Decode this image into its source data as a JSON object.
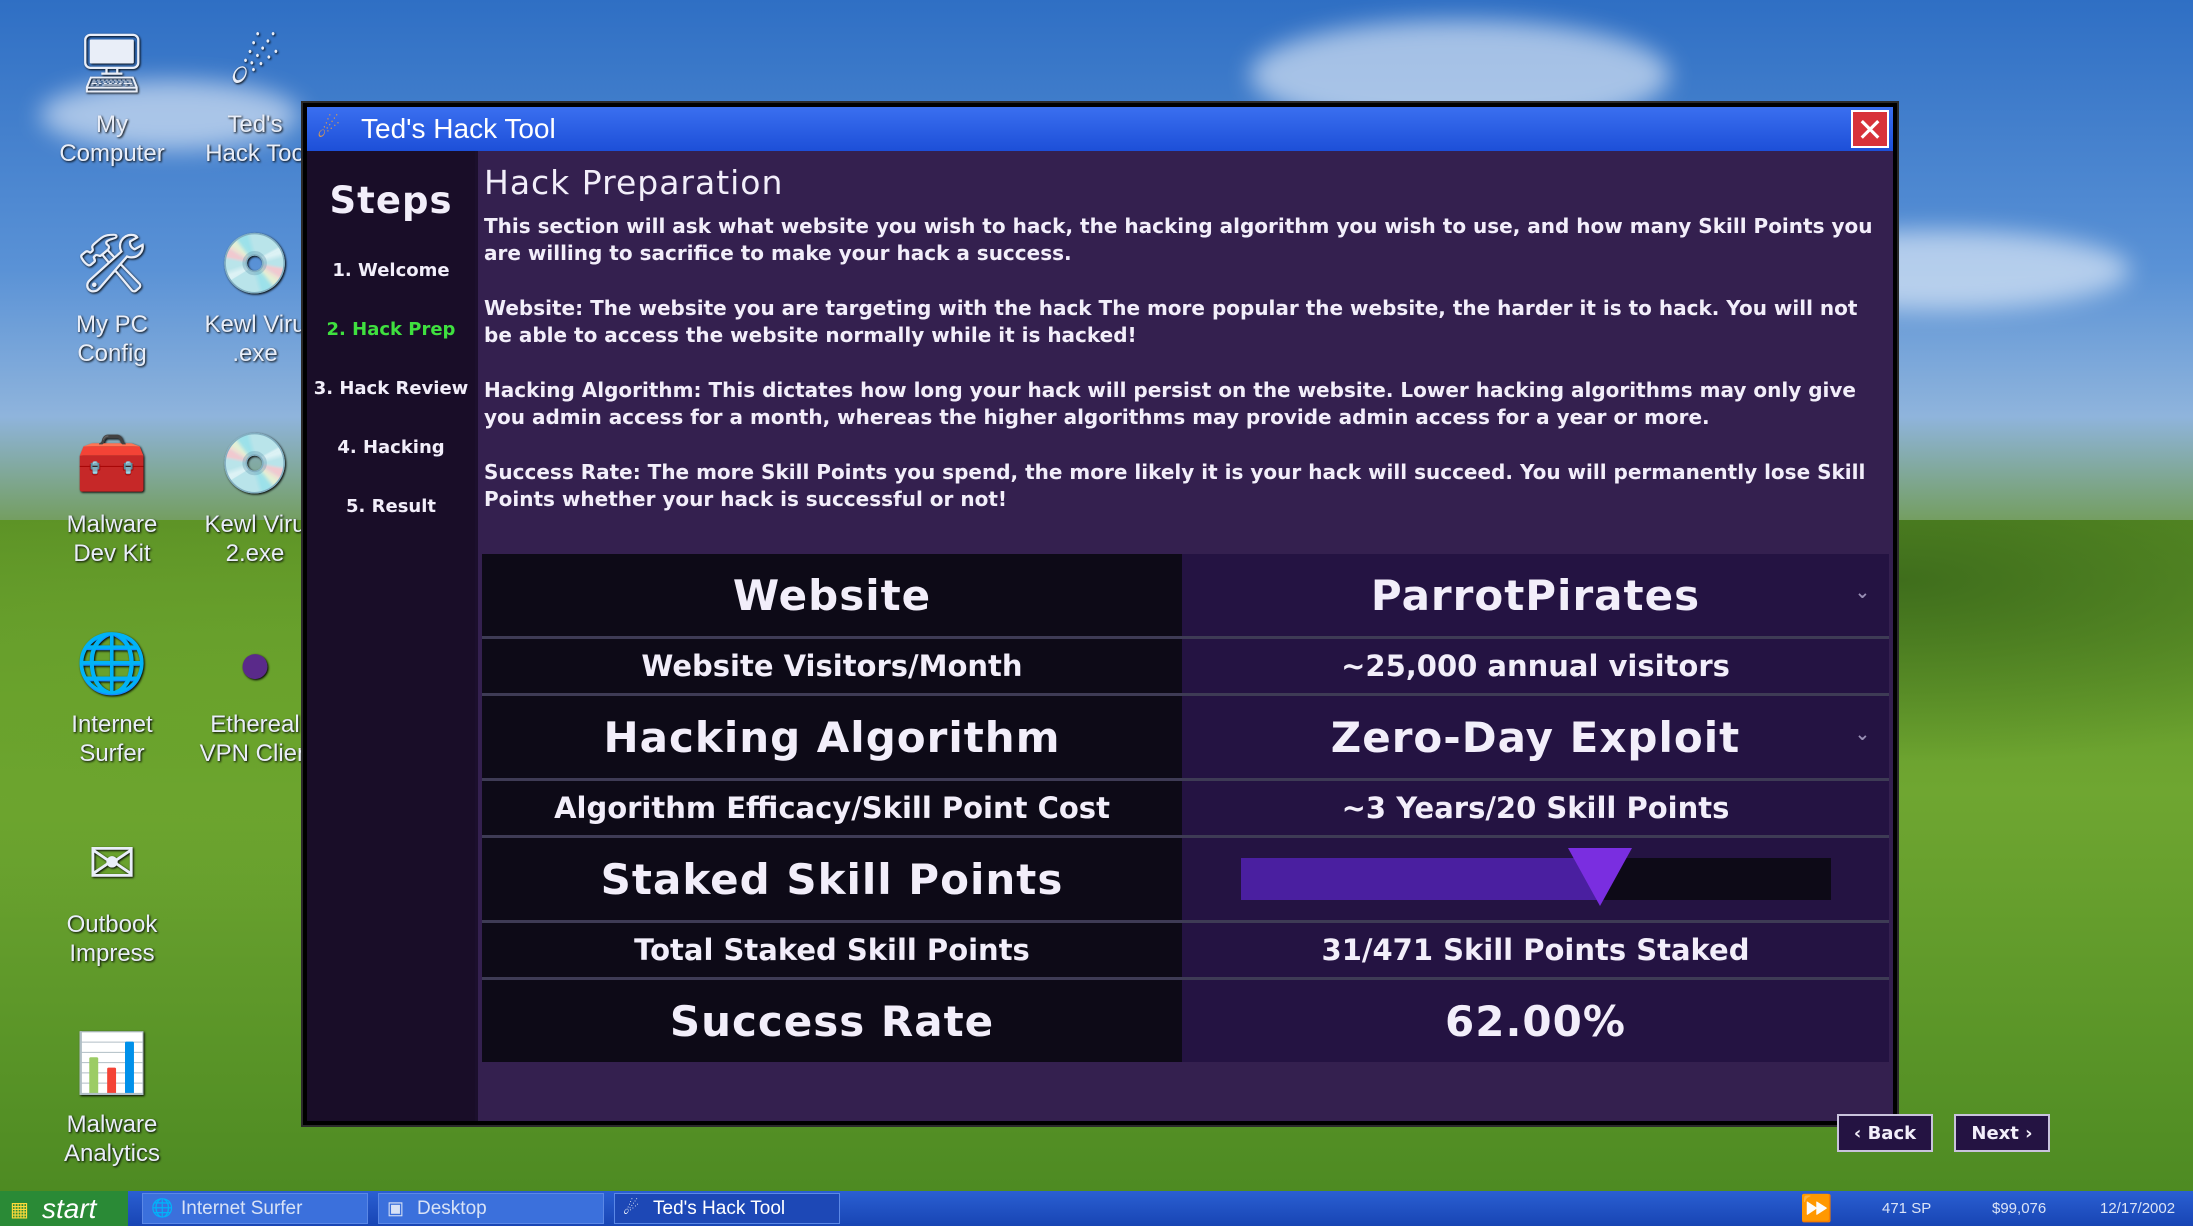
{
  "desktop": {
    "icons": [
      {
        "label": "My\nComputer",
        "icon": "monitor-icon"
      },
      {
        "label": "Ted's\nHack Too",
        "icon": "hack-tool-icon"
      },
      {
        "label": "My PC\nConfig",
        "icon": "tools-icon"
      },
      {
        "label": "Kewl Viru\n.exe",
        "icon": "cd-icon"
      },
      {
        "label": "Malware\nDev Kit",
        "icon": "toolbox-icon"
      },
      {
        "label": "Kewl Viru\n2.exe",
        "icon": "cd-icon"
      },
      {
        "label": "Internet\nSurfer",
        "icon": "globe-icon"
      },
      {
        "label": "Ethereal\nVPN Clien",
        "icon": "vpn-icon"
      },
      {
        "label": "Outbook\nImpress",
        "icon": "mail-icon"
      },
      {
        "label": "Malware\nAnalytics",
        "icon": "chart-icon"
      }
    ]
  },
  "window": {
    "title": "Ted's Hack Tool",
    "close_glyph": "✕",
    "steps": {
      "title": "Steps",
      "items": [
        "1. Welcome",
        "2. Hack Prep",
        "3. Hack Review",
        "4. Hacking",
        "5. Result"
      ],
      "active_index": 1
    },
    "heading": "Hack Preparation",
    "paragraphs": [
      "This section will ask what website you wish to hack, the hacking algorithm you wish to use, and how many Skill Points you are willing to sacrifice to make your hack a success.",
      "Website: The website you are targeting with the hack The more popular the website, the harder it is to hack. You will not be able to access the website normally while it is hacked!",
      "Hacking Algorithm: This dictates how long your hack will persist on the website. Lower hacking algorithms may only give you admin access for a month, whereas the higher algorithms may provide admin access for a year or more.",
      "Success Rate: The more Skill Points you spend, the more likely it is your hack will succeed. You will permanently lose Skill Points whether your hack is successful or not!"
    ],
    "form": {
      "website_label": "Website",
      "website_value": "ParrotPirates",
      "visitors_label": "Website Visitors/Month",
      "visitors_value": "~25,000 annual visitors",
      "algorithm_label": "Hacking Algorithm",
      "algorithm_value": "Zero-Day Exploit",
      "efficacy_label": "Algorithm Efficacy/Skill Point Cost",
      "efficacy_value": "~3 Years/20 Skill Points",
      "staked_label": "Staked Skill Points",
      "staked_level": 0.61,
      "total_label": "Total Staked Skill Points",
      "total_value": "31/471 Skill Points Staked",
      "success_label": "Success Rate",
      "success_value": "62.00%"
    },
    "buttons": {
      "back": "‹ Back",
      "next": "Next ›"
    }
  },
  "taskbar": {
    "start": "start",
    "tasks": [
      "Internet Surfer",
      "Desktop",
      "Ted's Hack Tool"
    ],
    "tray": {
      "sp": "471 SP",
      "money": "$99,076",
      "date": "12/17/2002",
      "arrows": "⏩"
    }
  }
}
